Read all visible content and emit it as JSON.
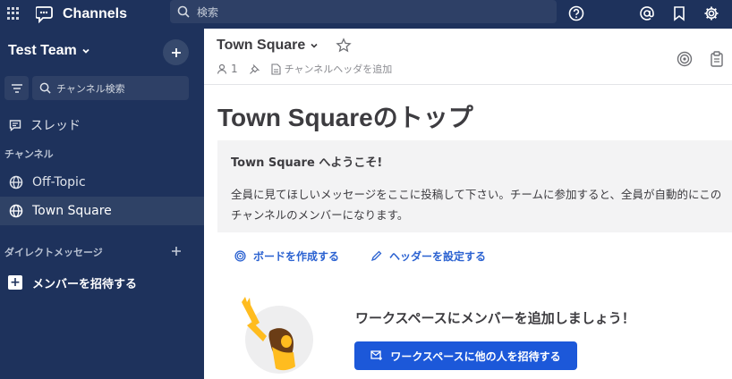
{
  "global_header": {
    "product_title": "Channels",
    "search_placeholder": "検索"
  },
  "sidebar": {
    "team_name": "Test Team",
    "find_channel_placeholder": "チャンネル検索",
    "threads_label": "スレッド",
    "channels_section": "チャンネル",
    "channels": [
      {
        "label": "Off-Topic",
        "active": false
      },
      {
        "label": "Town Square",
        "active": true
      }
    ],
    "dm_section": "ダイレクトメッセージ",
    "invite_label": "メンバーを招待する"
  },
  "channel_header": {
    "title": "Town Square",
    "member_count": "1",
    "add_header_text": "チャンネルヘッダを追加"
  },
  "intro": {
    "title": "Town Squareのトップ",
    "welcome": "Town Square へようこそ!",
    "body": "全員に見てほしいメッセージをここに投稿して下さい。チームに参加すると、全員が自動的にこのチャンネルのメンバーになります。",
    "create_board": "ボードを作成する",
    "set_header": "ヘッダーを設定する",
    "invite_title": "ワークスペースにメンバーを追加しましょう！",
    "invite_button": "ワークスペースに他の人を招待する"
  },
  "colors": {
    "sidebar_bg": "#1e325c",
    "accent": "#1c58d9",
    "link": "#2b62d1"
  }
}
